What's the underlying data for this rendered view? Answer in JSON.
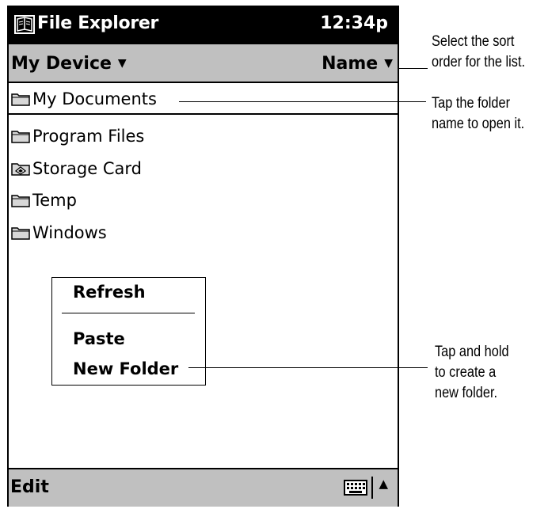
{
  "titlebar": {
    "app_name": "File Explorer",
    "time": "12:34p",
    "app_icon": "file-explorer-icon"
  },
  "navbar": {
    "location": "My Device",
    "sort_by": "Name"
  },
  "folders": [
    {
      "name": "My Documents",
      "icon": "folder-icon",
      "selected": true
    },
    {
      "name": "Program Files",
      "icon": "folder-icon",
      "selected": false
    },
    {
      "name": "Storage Card",
      "icon": "storage-card-icon",
      "selected": false
    },
    {
      "name": "Temp",
      "icon": "folder-icon",
      "selected": false
    },
    {
      "name": "Windows",
      "icon": "folder-icon",
      "selected": false
    }
  ],
  "context_menu": {
    "refresh": "Refresh",
    "paste": "Paste",
    "new_folder": "New Folder"
  },
  "bottombar": {
    "edit": "Edit",
    "keyboard_icon": "keyboard-icon",
    "up_icon": "triangle-up-icon"
  },
  "callouts": {
    "sort": [
      "Select the sort",
      "order for the list."
    ],
    "tap_folder": [
      "Tap the folder",
      "name to open it."
    ],
    "tap_hold": [
      "Tap and hold",
      "to create a",
      "new folder."
    ]
  },
  "colors": {
    "titlebar_bg": "#000000",
    "bar_bg": "#c0c0c0",
    "text": "#000000"
  }
}
